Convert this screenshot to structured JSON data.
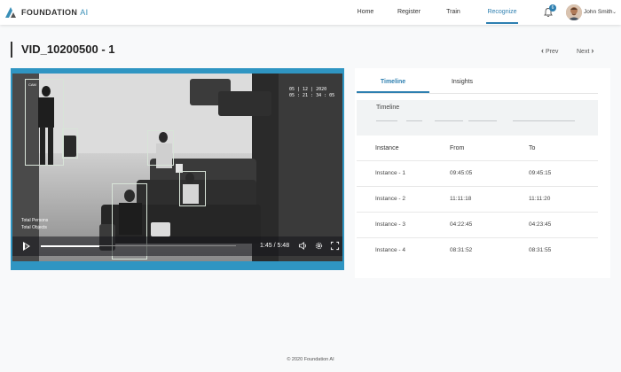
{
  "brand": {
    "name": "FOUNDATION",
    "suffix": "AI"
  },
  "nav": {
    "items": [
      "Home",
      "Register",
      "Train",
      "Recognize"
    ],
    "active": "Recognize"
  },
  "notifications": {
    "count": "6"
  },
  "user": {
    "name": "John Smith"
  },
  "page": {
    "title": "VID_10200500 - 1",
    "prev_label": "Prev",
    "next_label": "Next"
  },
  "video": {
    "date": "05 | 12 | 2020",
    "clock": "05 : 21 : 34 : 05",
    "stat_labels": [
      "Total Persons",
      "Total Objects"
    ],
    "camera_label": "CAM",
    "time": "1:45 / 5:48",
    "progress": 0.3
  },
  "tabs": {
    "timeline": "Timeline",
    "insights": "Insights",
    "active": "Timeline"
  },
  "timeline": {
    "label": "Timeline"
  },
  "table": {
    "headers": [
      "Instance",
      "From",
      "To"
    ],
    "rows": [
      [
        "Instance - 1",
        "09:45:05",
        "09:45:15"
      ],
      [
        "Instance - 2",
        "11:11:18",
        "11:11:20"
      ],
      [
        "Instance - 3",
        "04:22:45",
        "04:23:45"
      ],
      [
        "Instance - 4",
        "08:31:52",
        "08:31:55"
      ]
    ]
  },
  "footer": {
    "text": "© 2020 Foundation AI"
  },
  "colors": {
    "accent": "#2d7fb0",
    "video_border": "#2f95c2"
  }
}
